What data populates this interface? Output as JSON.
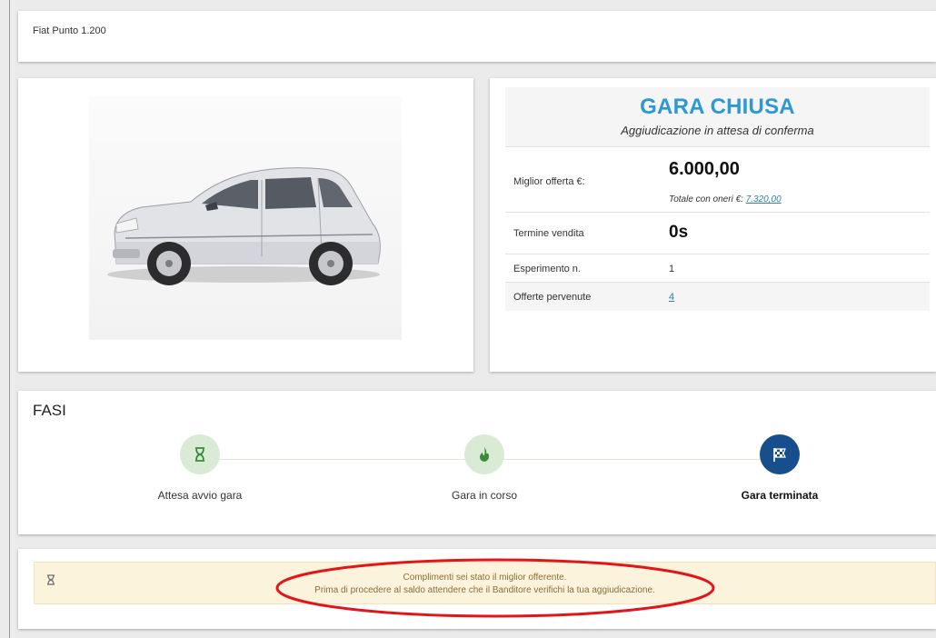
{
  "lot": {
    "title": "Fiat Punto 1.200"
  },
  "auction": {
    "status_title": "GARA CHIUSA",
    "status_subtitle": "Aggiudicazione in attesa di conferma",
    "best_offer_label": "Miglior offerta €:",
    "best_offer_value": "6.000,00",
    "total_label": "Totale con oneri €:",
    "total_value": "7.320,00",
    "term_label": "Termine vendita",
    "term_value": "0s",
    "experiment_label": "Esperimento n.",
    "experiment_value": "1",
    "offers_label": "Offerte pervenute",
    "offers_value": "4"
  },
  "phases": {
    "title": "FASI",
    "items": [
      {
        "label": "Attesa avvio gara",
        "icon": "hourglass-icon",
        "active": false
      },
      {
        "label": "Gara in corso",
        "icon": "fire-icon",
        "active": false
      },
      {
        "label": "Gara terminata",
        "icon": "checkered-flag-icon",
        "active": true
      }
    ]
  },
  "message": {
    "icon": "hourglass-icon",
    "line1": "Complimenti sei stato il miglior offerente.",
    "line2": "Prima di procedere al saldo attendere che il Banditore verifichi la tua aggiudicazione."
  },
  "colors": {
    "accent_blue": "#2c98d4",
    "phase_inactive": "#d9ebd4",
    "phase_active": "#174f8c",
    "alert_bg": "#fbf3dc",
    "annotation_red": "#e0161b"
  }
}
